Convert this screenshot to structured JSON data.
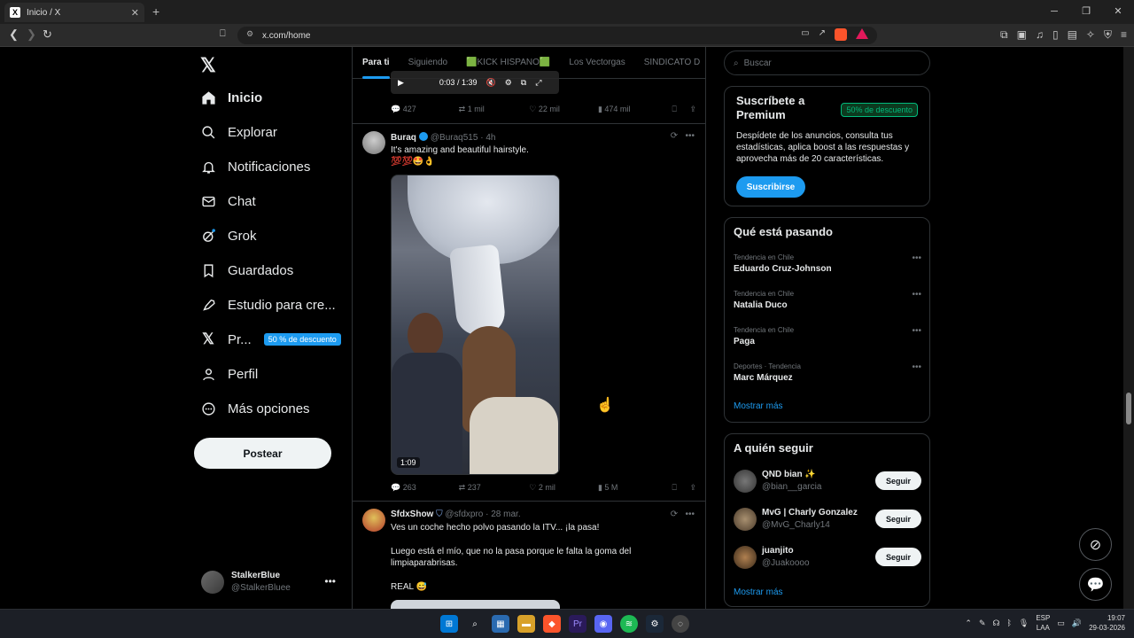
{
  "browser": {
    "tab_title": "Inicio / X",
    "url": "x.com/home",
    "new_tab": "+",
    "tab_close": "✕"
  },
  "nav": {
    "items": [
      {
        "label": "Inicio",
        "icon": "home-icon"
      },
      {
        "label": "Explorar",
        "icon": "search-icon"
      },
      {
        "label": "Notificaciones",
        "icon": "bell-icon"
      },
      {
        "label": "Chat",
        "icon": "mail-icon"
      },
      {
        "label": "Grok",
        "icon": "grok-icon"
      },
      {
        "label": "Guardados",
        "icon": "bookmark-icon"
      },
      {
        "label": "Estudio para cre...",
        "icon": "rocket-icon"
      },
      {
        "label": "Pr...",
        "icon": "x-icon"
      },
      {
        "label": "Perfil",
        "icon": "person-icon"
      },
      {
        "label": "Más opciones",
        "icon": "more-circle-icon"
      }
    ],
    "premium_badge": "50 % de descuento",
    "post_button": "Postear",
    "account": {
      "name": "StalkerBlue",
      "handle": "@StalkerBluee"
    }
  },
  "timeline": {
    "tabs": [
      "Para ti",
      "Siguiendo",
      "🟩KICK HISPANO🟩",
      "Los Vectorgas",
      "SINDICATO D"
    ],
    "video_top": {
      "time": "0:03 / 1:39"
    },
    "tweet0_stats": {
      "replies": "427",
      "reposts": "1 mil",
      "likes": "22 mil",
      "views": "474 mil"
    },
    "tweet1": {
      "name": "Buraq",
      "handle": "@Buraq515",
      "time": "· 4h",
      "text": "It's amazing and beautiful hairstyle.",
      "emojis": "💯💯🤩👌",
      "video_duration": "1:09",
      "stats": {
        "replies": "263",
        "reposts": "237",
        "likes": "2 mil",
        "views": "5 M"
      }
    },
    "tweet2": {
      "name": "SfdxShow",
      "handle": "@sfdxpro",
      "time": "· 28 mar.",
      "line1": "Ves un coche hecho polvo pasando la ITV... ¡la pasa!",
      "line2": "Luego está el mío, que no la pasa porque le falta la goma del limpiaparabrisas.",
      "line3": "REAL 😅"
    }
  },
  "right": {
    "search_placeholder": "Buscar",
    "premium": {
      "title": "Suscríbete a Premium",
      "badge": "50% de descuento",
      "text": "Despídete de los anuncios, consulta tus estadísticas, aplica boost a las respuestas y aprovecha más de 20 características.",
      "button": "Suscribirse"
    },
    "trends": {
      "title": "Qué está pasando",
      "items": [
        {
          "context": "Tendencia en Chile",
          "name": "Eduardo Cruz-Johnson"
        },
        {
          "context": "Tendencia en Chile",
          "name": "Natalia Duco"
        },
        {
          "context": "Tendencia en Chile",
          "name": "Paga"
        },
        {
          "context": "Deportes · Tendencia",
          "name": "Marc Márquez"
        }
      ],
      "more": "Mostrar más"
    },
    "follow": {
      "title": "A quién seguir",
      "items": [
        {
          "name": "QND bian ✨",
          "handle": "@bian__garcia",
          "button": "Seguir"
        },
        {
          "name": "MvG | Charly Gonzalez",
          "handle": "@MvG_Charly14",
          "button": "Seguir"
        },
        {
          "name": "juanjito",
          "handle": "@Juakoooo",
          "button": "Seguir"
        }
      ],
      "more": "Mostrar más"
    }
  },
  "taskbar": {
    "lang1": "ESP",
    "lang2": "LAA",
    "time": "19:07",
    "date": "29-03-2026"
  }
}
